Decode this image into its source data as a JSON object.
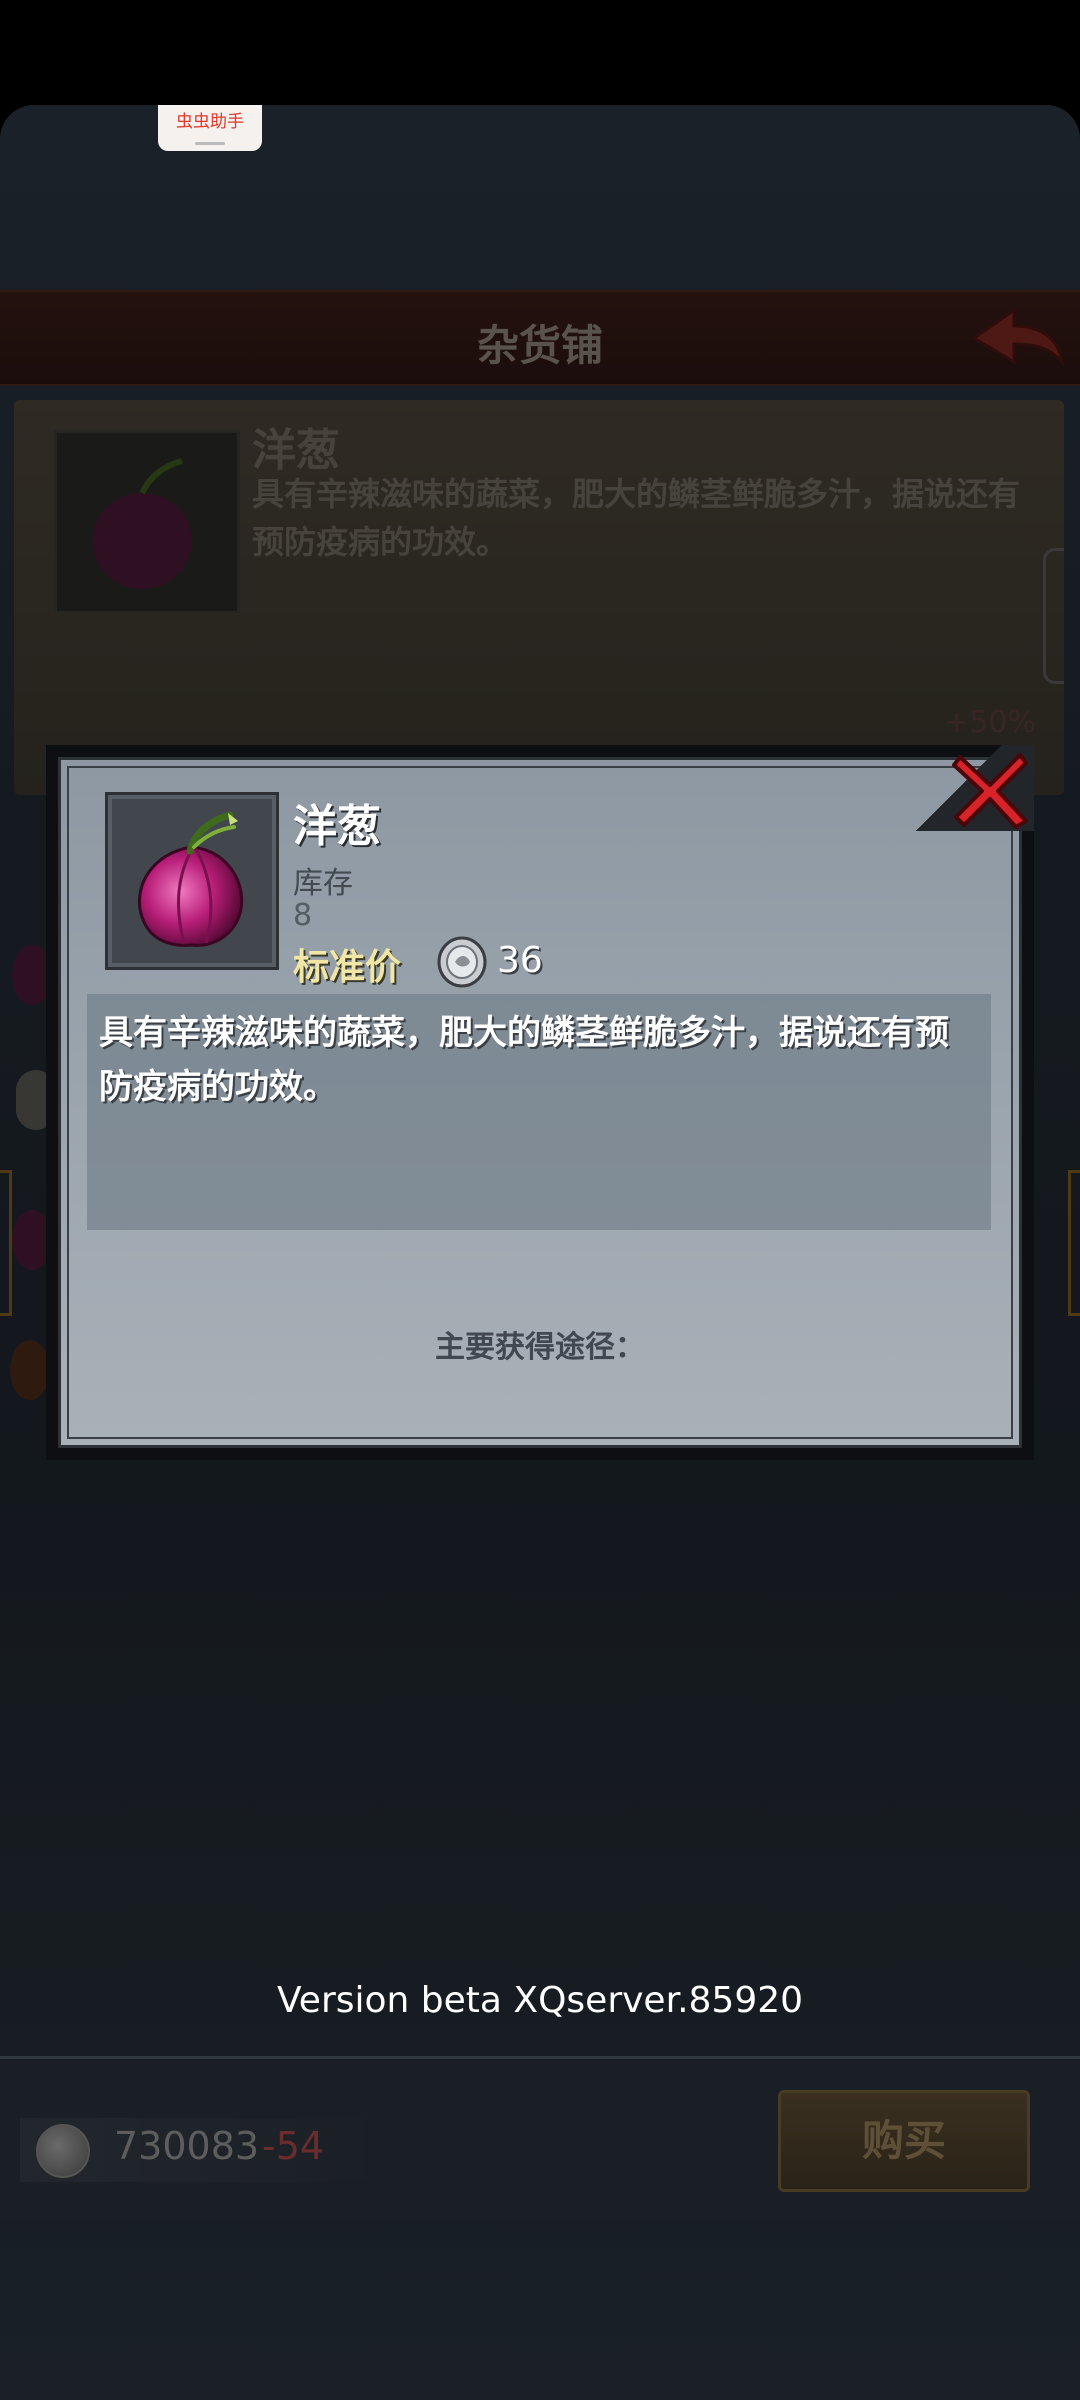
{
  "helper": {
    "label": "虫虫助手"
  },
  "shop": {
    "title": "杂货铺",
    "item_name": "洋葱",
    "item_desc": "具有辛辣滋味的蔬菜，肥大的鳞茎鲜脆多汁，据说还有预防疫病的功效。",
    "bonus": "+50%"
  },
  "dialog": {
    "name": "洋葱",
    "stock_label": "库存",
    "stock_value": "8",
    "price_label": "标准价",
    "price_value": "36",
    "description": "具有辛辣滋味的蔬菜，肥大的鳞茎鲜脆多汁，据说还有预防疫病的功效。",
    "source_label": "主要获得途径："
  },
  "footer": {
    "version": "Version beta XQserver.85920",
    "money": "730083",
    "money_delta": "-54",
    "buy_label": "购买"
  },
  "colors": {
    "accent_gold": "#f2e6a6",
    "close_red": "#d8232a",
    "negative": "#6a2c2c"
  },
  "icons": [
    "onion-icon",
    "silver-coin-icon",
    "back-arrow-icon",
    "close-icon"
  ]
}
